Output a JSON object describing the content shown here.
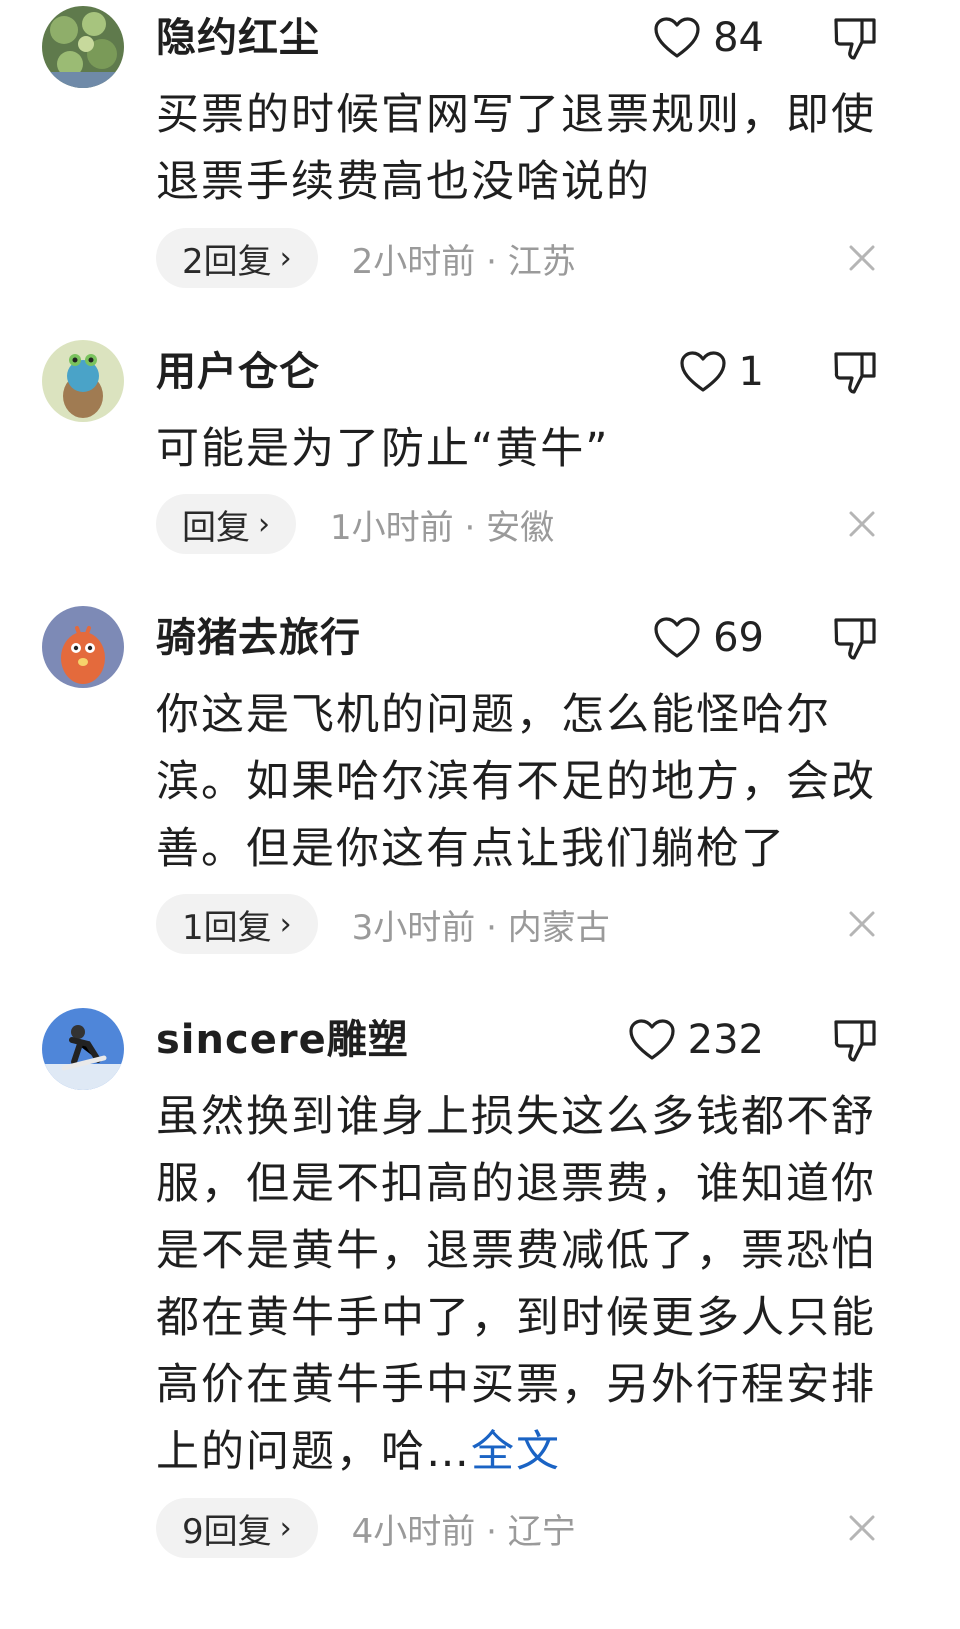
{
  "comments": [
    {
      "username": "隐约红尘",
      "likes": "84",
      "text": "买票的时候官网写了退票规则，即使退票手续费高也没啥说的",
      "reply": "2回复",
      "time": "2小时前",
      "location": "江苏",
      "avatar_icon": "lily-pad-avatar"
    },
    {
      "username": "用户仓仑",
      "likes": "1",
      "text": "可能是为了防止“黄牛”",
      "reply": "回复",
      "time": "1小时前",
      "location": "安徽",
      "avatar_icon": "cartoon-avatar"
    },
    {
      "username": "骑猪去旅行",
      "likes": "69",
      "text": "你这是飞机的问题，怎么能怪哈尔滨。如果哈尔滨有不足的地方，会改善。但是你这有点让我们躺枪了",
      "reply": "1回复",
      "time": "3小时前",
      "location": "内蒙古",
      "avatar_icon": "bird-avatar"
    },
    {
      "username": "sincere雕塑",
      "likes": "232",
      "text": "虽然换到谁身上损失这么多钱都不舒服，但是不扣高的退票费，谁知道你是不是黄牛，退票费减低了，票恐怕都在黄牛手中了，到时候更多人只能高价在黄牛手中买票，另外行程安排上的问题，哈…",
      "full_text_link": "全文",
      "reply": "9回复",
      "time": "4小时前",
      "location": "辽宁",
      "avatar_icon": "snowboarder-avatar"
    }
  ],
  "separator": " · ",
  "colors": {
    "text": "#1f1f1f",
    "meta": "#9a9a9a",
    "link": "#1a63c4",
    "pill_bg": "#f2f2f2"
  }
}
